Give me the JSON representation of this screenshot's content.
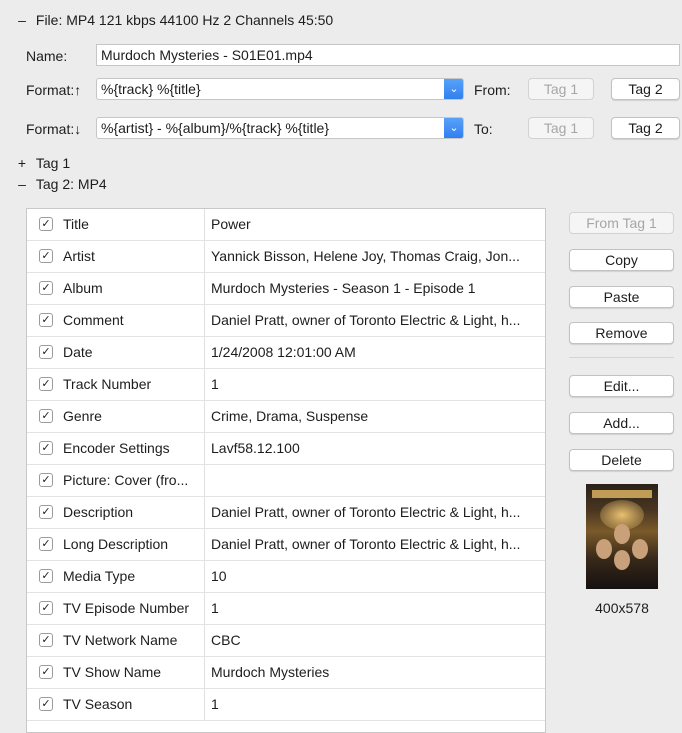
{
  "file_header": {
    "disclosure": "–",
    "text": "File: MP4 121 kbps 44100 Hz 2 Channels 45:50"
  },
  "name_row": {
    "label": "Name:",
    "value": "Murdoch Mysteries - S01E01.mp4"
  },
  "format_up": {
    "label": "Format:↑",
    "value": "%{track} %{title}",
    "side_label": "From:",
    "buttons": [
      "Tag 1",
      "Tag 2"
    ]
  },
  "format_down": {
    "label": "Format:↓",
    "value": "%{artist} - %{album}/%{track} %{title}",
    "side_label": "To:",
    "buttons": [
      "Tag 1",
      "Tag 2"
    ]
  },
  "sections": [
    {
      "disclosure": "+",
      "label": "Tag 1"
    },
    {
      "disclosure": "–",
      "label": "Tag 2: MP4"
    }
  ],
  "frames": [
    {
      "name": "Title",
      "value": "Power"
    },
    {
      "name": "Artist",
      "value": "Yannick Bisson, Helene Joy, Thomas Craig, Jon..."
    },
    {
      "name": "Album",
      "value": "Murdoch Mysteries - Season 1 - Episode 1"
    },
    {
      "name": "Comment",
      "value": "Daniel Pratt, owner of Toronto Electric & Light, h..."
    },
    {
      "name": "Date",
      "value": "1/24/2008 12:01:00 AM"
    },
    {
      "name": "Track Number",
      "value": "1"
    },
    {
      "name": "Genre",
      "value": "Crime, Drama, Suspense"
    },
    {
      "name": "Encoder Settings",
      "value": "Lavf58.12.100"
    },
    {
      "name": "Picture: Cover (fro...",
      "value": ""
    },
    {
      "name": "Description",
      "value": "Daniel Pratt, owner of Toronto Electric & Light, h..."
    },
    {
      "name": "Long Description",
      "value": "Daniel Pratt, owner of Toronto Electric & Light, h..."
    },
    {
      "name": "Media Type",
      "value": "10"
    },
    {
      "name": "TV Episode Number",
      "value": "1"
    },
    {
      "name": "TV Network Name",
      "value": "CBC"
    },
    {
      "name": "TV Show Name",
      "value": "Murdoch Mysteries"
    },
    {
      "name": "TV Season",
      "value": "1"
    }
  ],
  "checkmark": "✓",
  "combo_arrow": "⌄",
  "side_buttons": {
    "from_tag": "From Tag 1",
    "copy": "Copy",
    "paste": "Paste",
    "remove": "Remove",
    "edit": "Edit...",
    "add": "Add...",
    "delete": "Delete"
  },
  "cover": {
    "dimensions": "400x578"
  },
  "colors": {
    "accent": "#2f7df0",
    "background": "#ececec"
  }
}
